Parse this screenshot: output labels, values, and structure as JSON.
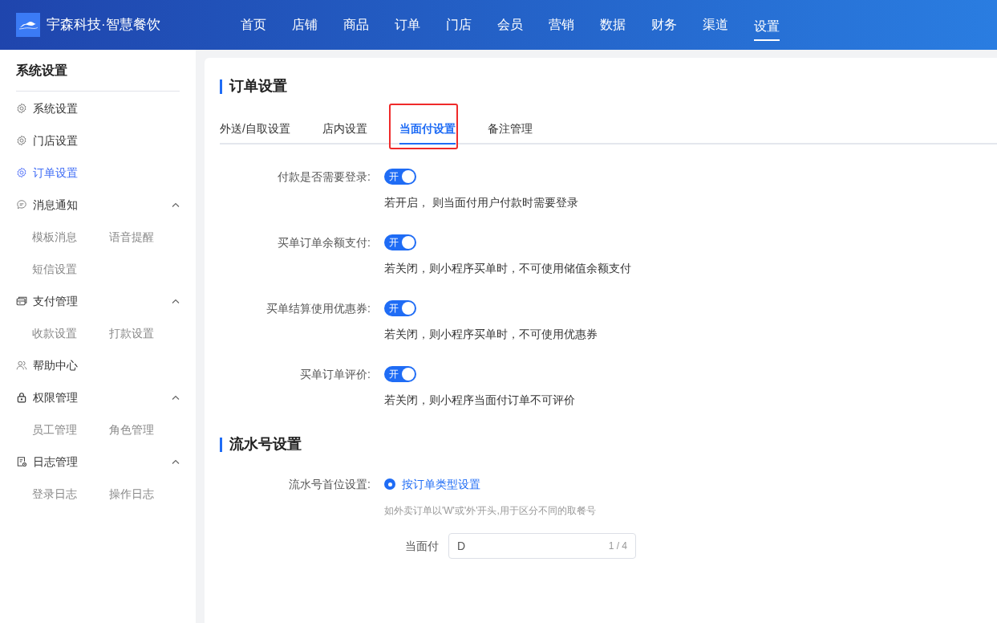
{
  "header": {
    "brand": "宇森科技·智慧餐饮",
    "nav": [
      {
        "label": "首页",
        "selected": false
      },
      {
        "label": "店铺",
        "selected": false
      },
      {
        "label": "商品",
        "selected": false
      },
      {
        "label": "订单",
        "selected": false
      },
      {
        "label": "门店",
        "selected": false
      },
      {
        "label": "会员",
        "selected": false
      },
      {
        "label": "营销",
        "selected": false
      },
      {
        "label": "数据",
        "selected": false
      },
      {
        "label": "财务",
        "selected": false
      },
      {
        "label": "渠道",
        "selected": false
      },
      {
        "label": "设置",
        "selected": true
      }
    ]
  },
  "sidebar": {
    "title": "系统设置",
    "items": [
      {
        "label": "系统设置",
        "selected": false
      },
      {
        "label": "门店设置",
        "selected": false
      },
      {
        "label": "订单设置",
        "selected": true
      },
      {
        "label": "消息通知",
        "selected": false,
        "expanded": true,
        "children": [
          {
            "label": "模板消息"
          },
          {
            "label": "语音提醒"
          },
          {
            "label": "短信设置"
          }
        ]
      },
      {
        "label": "支付管理",
        "selected": false,
        "expanded": true,
        "children": [
          {
            "label": "收款设置"
          },
          {
            "label": "打款设置"
          }
        ]
      },
      {
        "label": "帮助中心",
        "selected": false
      },
      {
        "label": "权限管理",
        "selected": false,
        "expanded": true,
        "children": [
          {
            "label": "员工管理"
          },
          {
            "label": "角色管理"
          }
        ]
      },
      {
        "label": "日志管理",
        "selected": false,
        "expanded": true,
        "children": [
          {
            "label": "登录日志"
          },
          {
            "label": "操作日志"
          }
        ]
      }
    ]
  },
  "main": {
    "title": "订单设置",
    "tabs": [
      {
        "label": "外送/自取设置",
        "selected": false,
        "highlighted": false
      },
      {
        "label": "店内设置",
        "selected": false,
        "highlighted": false
      },
      {
        "label": "当面付设置",
        "selected": true,
        "highlighted": true
      },
      {
        "label": "备注管理",
        "selected": false,
        "highlighted": false
      }
    ],
    "settings": [
      {
        "label": "付款是否需要登录:",
        "on": true,
        "switch_text": "开",
        "hint": "若开启， 则当面付用户付款时需要登录"
      },
      {
        "label": "买单订单余额支付:",
        "on": true,
        "switch_text": "开",
        "hint": "若关闭，则小程序买单时，不可使用储值余额支付"
      },
      {
        "label": "买单结算使用优惠券:",
        "on": true,
        "switch_text": "开",
        "hint": "若关闭，则小程序买单时，不可使用优惠券"
      },
      {
        "label": "买单订单评价:",
        "on": true,
        "switch_text": "开",
        "hint": "若关闭，则小程序当面付订单不可评价"
      }
    ],
    "serial": {
      "title": "流水号设置",
      "label": "流水号首位设置:",
      "radio": {
        "label": "按订单类型设置",
        "selected": true
      },
      "hint": "如外卖订单以'W'或'外'开头,用于区分不同的取餐号",
      "field": {
        "label": "当面付",
        "value": "D",
        "counter": "1 / 4"
      }
    }
  }
}
